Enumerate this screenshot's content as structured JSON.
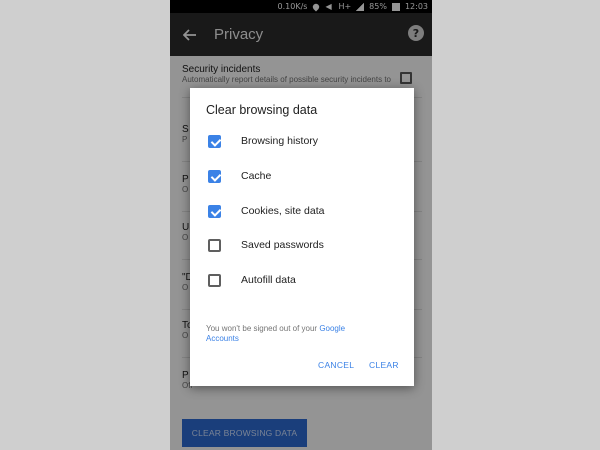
{
  "statusbar": {
    "speed": "0.10K/s",
    "network": "H+",
    "battery": "85%",
    "time": "12:03"
  },
  "toolbar": {
    "title": "Privacy",
    "back_icon": "arrow-left-icon",
    "help_icon": "help-circle-icon",
    "help_glyph": "?"
  },
  "settings": {
    "security": {
      "title": "Security incidents",
      "subtitle": "Automatically report details of possible security incidents to Google",
      "checked": false
    },
    "row2": {
      "title": "S",
      "subtitle": "P",
      "checked": true
    },
    "row3": {
      "title": "P",
      "subtitle": "O"
    },
    "row4": {
      "title": "U",
      "subtitle": "O"
    },
    "row5": {
      "title": "\"D",
      "subtitle": "O"
    },
    "row6": {
      "title": "To",
      "subtitle": "O"
    },
    "row7": {
      "title": "P",
      "subtitle": "Off"
    },
    "clear_button": "CLEAR BROWSING DATA"
  },
  "dialog": {
    "title": "Clear browsing data",
    "options": [
      {
        "label": "Browsing history",
        "checked": true
      },
      {
        "label": "Cache",
        "checked": true
      },
      {
        "label": "Cookies, site data",
        "checked": true
      },
      {
        "label": "Saved passwords",
        "checked": false
      },
      {
        "label": "Autofill data",
        "checked": false
      }
    ],
    "note_prefix": "You won't be signed out of your ",
    "note_link": "Google Accounts",
    "cancel": "CANCEL",
    "clear": "CLEAR"
  },
  "colors": {
    "accent": "#3b82e6",
    "toolbar": "#2b2b2b",
    "statusbar": "#000000"
  }
}
